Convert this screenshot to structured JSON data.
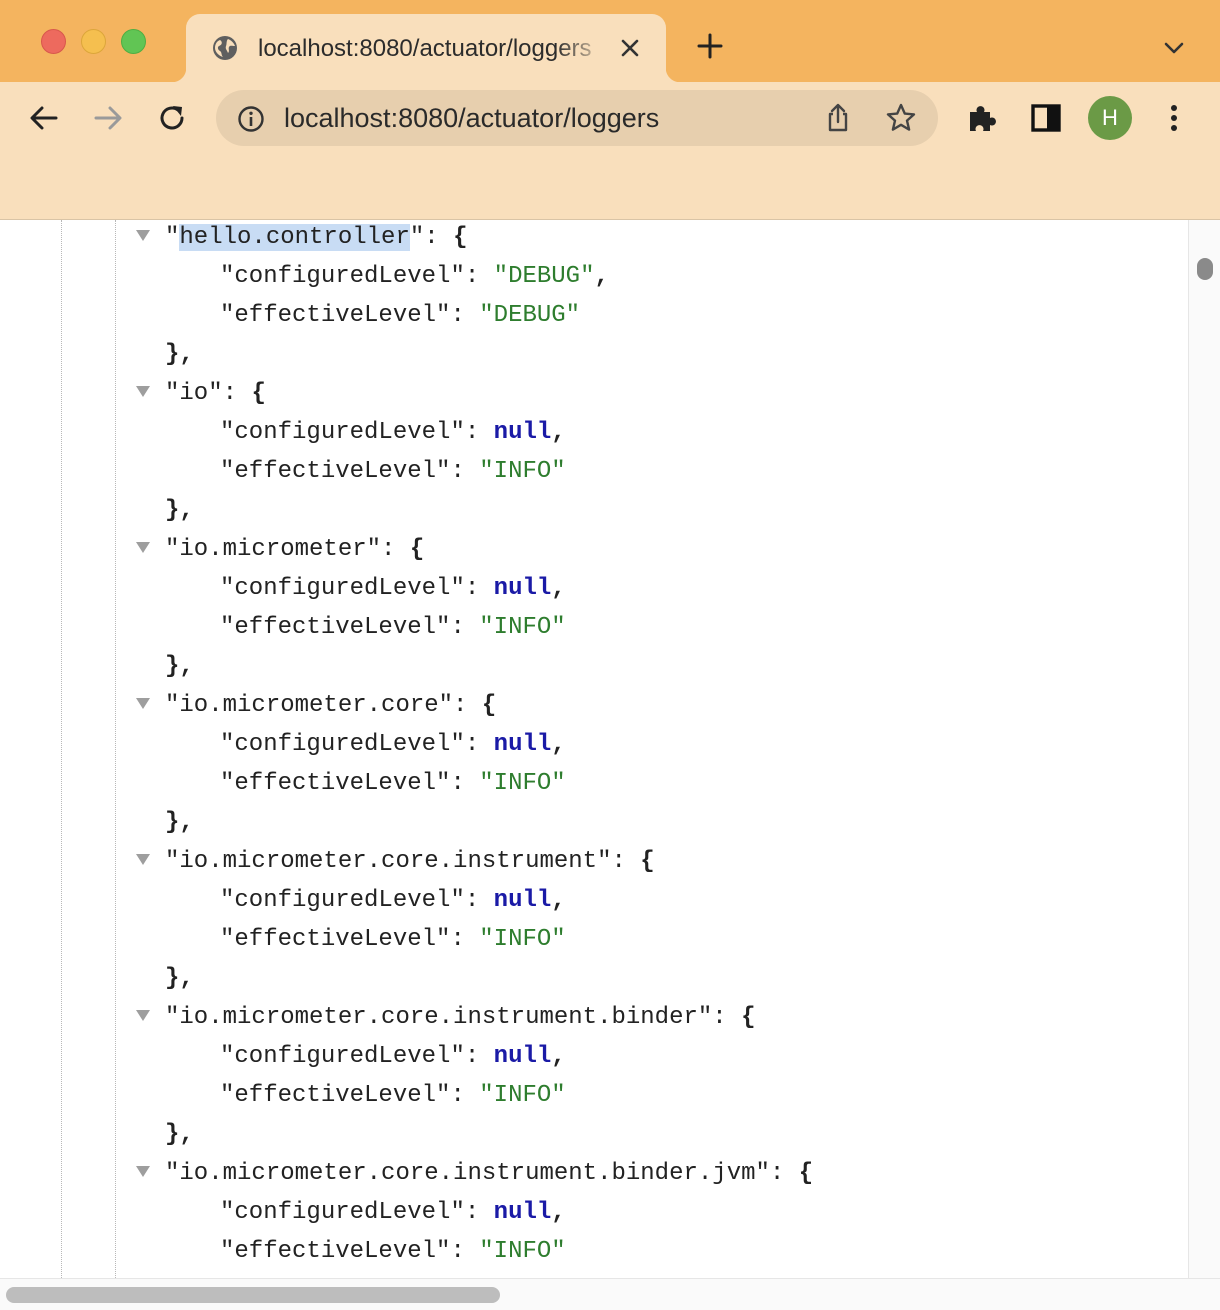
{
  "browser": {
    "tab_title": "localhost:8080/actuator/loggers",
    "address": "localhost:8080/actuator/loggers",
    "avatar_initial": "H",
    "accent_tabstrip": "#f4b45f",
    "accent_toolbar": "#f9dfbc"
  },
  "icons": {
    "tab_favicon": "globe-icon",
    "tab_close": "close-icon",
    "new_tab": "plus-icon",
    "tab_search": "chevron-down-icon",
    "back": "arrow-left-icon",
    "forward": "arrow-right-icon",
    "reload": "reload-icon",
    "site_info": "info-icon",
    "share": "share-icon",
    "bookmark": "star-icon",
    "extensions": "puzzle-icon",
    "side_panel": "side-panel-icon",
    "menu": "kebab-menu-icon"
  },
  "json_view": {
    "selected_key": "hello.controller",
    "entries": [
      {
        "name": "hello.controller",
        "configuredLevel": "\"DEBUG\"",
        "effectiveLevel": "\"DEBUG\""
      },
      {
        "name": "io",
        "configuredLevel": "null",
        "effectiveLevel": "\"INFO\""
      },
      {
        "name": "io.micrometer",
        "configuredLevel": "null",
        "effectiveLevel": "\"INFO\""
      },
      {
        "name": "io.micrometer.core",
        "configuredLevel": "null",
        "effectiveLevel": "\"INFO\""
      },
      {
        "name": "io.micrometer.core.instrument",
        "configuredLevel": "null",
        "effectiveLevel": "\"INFO\""
      },
      {
        "name": "io.micrometer.core.instrument.binder",
        "configuredLevel": "null",
        "effectiveLevel": "\"INFO\""
      },
      {
        "name": "io.micrometer.core.instrument.binder.jvm",
        "configuredLevel": "null",
        "effectiveLevel": "\"INFO\""
      }
    ],
    "field_configured": "configuredLevel",
    "field_effective": "effectiveLevel"
  }
}
